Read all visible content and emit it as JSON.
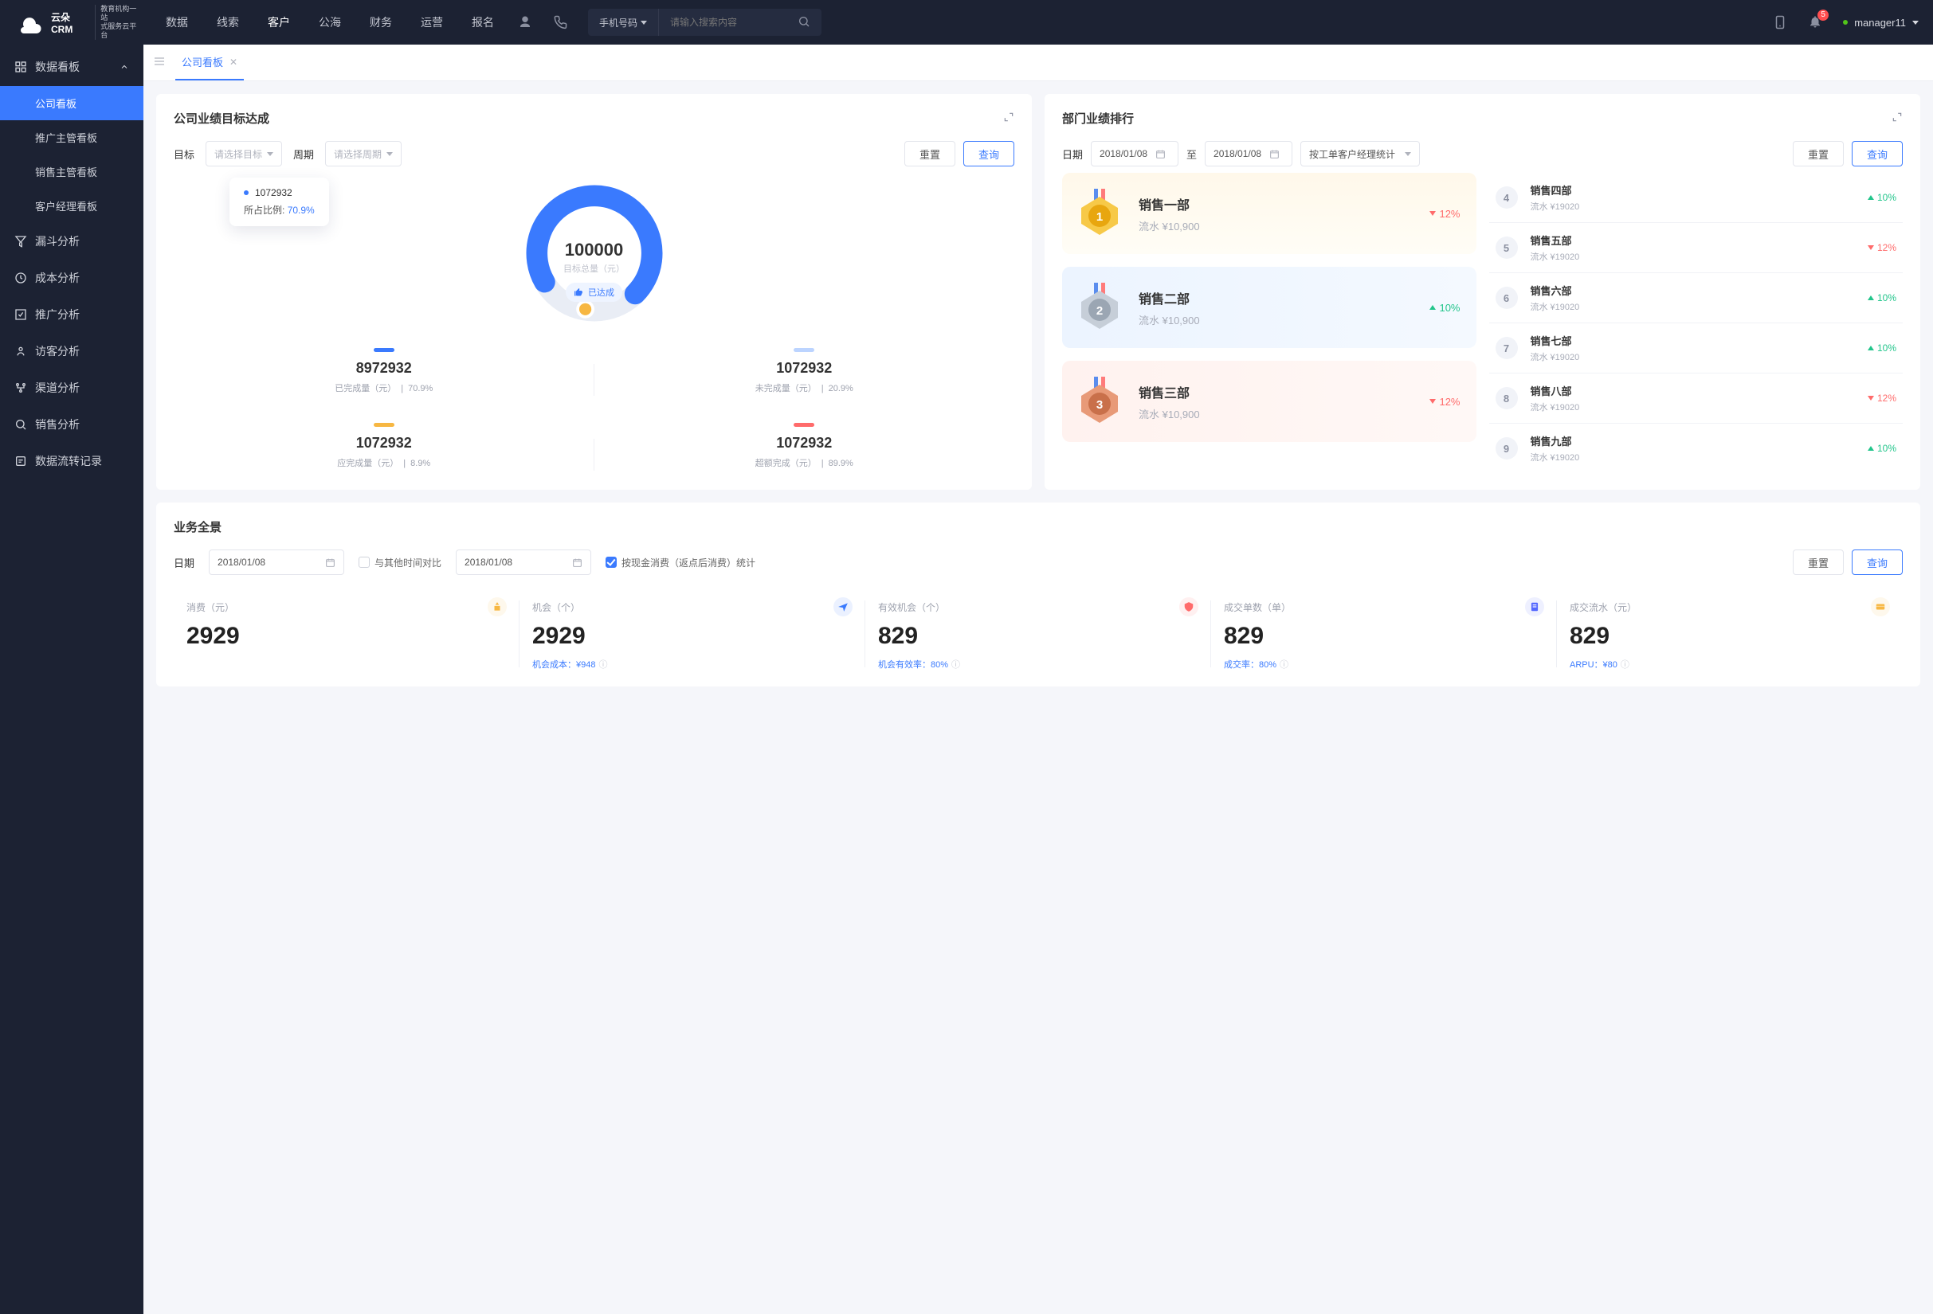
{
  "topnav": {
    "brand_main": "云朵CRM",
    "brand_sub": "教育机构一站\n式服务云平台",
    "items": [
      "数据",
      "线索",
      "客户",
      "公海",
      "财务",
      "运营",
      "报名"
    ],
    "active_index": 2,
    "search_scope": "手机号码",
    "search_placeholder": "请输入搜索内容",
    "notif_count": "5",
    "username": "manager11"
  },
  "sidebar": {
    "group_title": "数据看板",
    "sub_items": [
      "公司看板",
      "推广主管看板",
      "销售主管看板",
      "客户经理看板"
    ],
    "sub_active_index": 0,
    "items": [
      "漏斗分析",
      "成本分析",
      "推广分析",
      "访客分析",
      "渠道分析",
      "销售分析",
      "数据流转记录"
    ]
  },
  "tab": {
    "label": "公司看板"
  },
  "card1": {
    "title": "公司业绩目标达成",
    "label_target": "目标",
    "select_target_ph": "请选择目标",
    "label_period": "周期",
    "select_period_ph": "请选择周期",
    "btn_reset": "重置",
    "btn_query": "查询",
    "tooltip_value": "1072932",
    "tooltip_label": "所占比例:",
    "tooltip_pct": "70.9%",
    "donut_center_value": "100000",
    "donut_center_label": "目标总量（元）",
    "donut_badge": "已达成",
    "stats": [
      {
        "bar": "#3a7afe",
        "value": "8972932",
        "label": "已完成量（元）",
        "pct": "70.9%"
      },
      {
        "bar": "#bcd4ff",
        "value": "1072932",
        "label": "未完成量（元）",
        "pct": "20.9%"
      },
      {
        "bar": "#f7b742",
        "value": "1072932",
        "label": "应完成量（元）",
        "pct": "8.9%"
      },
      {
        "bar": "#ff6b6b",
        "value": "1072932",
        "label": "超额完成（元）",
        "pct": "89.9%"
      }
    ]
  },
  "card2": {
    "title": "部门业绩排行",
    "label_date": "日期",
    "date_from": "2018/01/08",
    "date_to": "2018/01/08",
    "range_sep": "至",
    "select_mode": "按工单客户经理统计",
    "btn_reset": "重置",
    "btn_query": "查询",
    "top3": [
      {
        "name": "销售一部",
        "rev": "流水 ¥10,900",
        "delta": "12%",
        "dir": "down"
      },
      {
        "name": "销售二部",
        "rev": "流水 ¥10,900",
        "delta": "10%",
        "dir": "up"
      },
      {
        "name": "销售三部",
        "rev": "流水 ¥10,900",
        "delta": "12%",
        "dir": "down"
      }
    ],
    "rest": [
      {
        "rank": "4",
        "name": "销售四部",
        "rev": "流水 ¥19020",
        "delta": "10%",
        "dir": "up"
      },
      {
        "rank": "5",
        "name": "销售五部",
        "rev": "流水 ¥19020",
        "delta": "12%",
        "dir": "down"
      },
      {
        "rank": "6",
        "name": "销售六部",
        "rev": "流水 ¥19020",
        "delta": "10%",
        "dir": "up"
      },
      {
        "rank": "7",
        "name": "销售七部",
        "rev": "流水 ¥19020",
        "delta": "10%",
        "dir": "up"
      },
      {
        "rank": "8",
        "name": "销售八部",
        "rev": "流水 ¥19020",
        "delta": "12%",
        "dir": "down"
      },
      {
        "rank": "9",
        "name": "销售九部",
        "rev": "流水 ¥19020",
        "delta": "10%",
        "dir": "up"
      }
    ]
  },
  "card3": {
    "title": "业务全景",
    "label_date": "日期",
    "date1": "2018/01/08",
    "compare_label": "与其他时间对比",
    "date2": "2018/01/08",
    "cash_label": "按现金消费（返点后消费）统计",
    "btn_reset": "重置",
    "btn_query": "查询",
    "kpis": [
      {
        "label": "消费（元）",
        "value": "2929",
        "foot": "",
        "color": "#f7b742"
      },
      {
        "label": "机会（个）",
        "value": "2929",
        "foot": "机会成本：¥948",
        "color": "#3a7afe"
      },
      {
        "label": "有效机会（个）",
        "value": "829",
        "foot": "机会有效率：80%",
        "color": "#ff6b6b"
      },
      {
        "label": "成交单数（单）",
        "value": "829",
        "foot": "成交率：80%",
        "color": "#5468ff"
      },
      {
        "label": "成交流水（元）",
        "value": "829",
        "foot": "ARPU：¥80",
        "color": "#f7b742"
      }
    ]
  },
  "chart_data": {
    "type": "pie",
    "title": "公司业绩目标达成",
    "total_label": "目标总量（元）",
    "total_value": 100000,
    "series": [
      {
        "name": "已完成量（元）",
        "value": 8972932,
        "pct": 70.9,
        "color": "#3a7afe"
      },
      {
        "name": "未完成量（元）",
        "value": 1072932,
        "pct": 20.9,
        "color": "#bcd4ff"
      },
      {
        "name": "应完成量（元）",
        "value": 1072932,
        "pct": 8.9,
        "color": "#f7b742"
      },
      {
        "name": "超额完成（元）",
        "value": 1072932,
        "pct": 89.9,
        "color": "#ff6b6b"
      }
    ],
    "tooltip": {
      "value": 1072932,
      "ratio_label": "所占比例",
      "ratio": 70.9
    }
  }
}
